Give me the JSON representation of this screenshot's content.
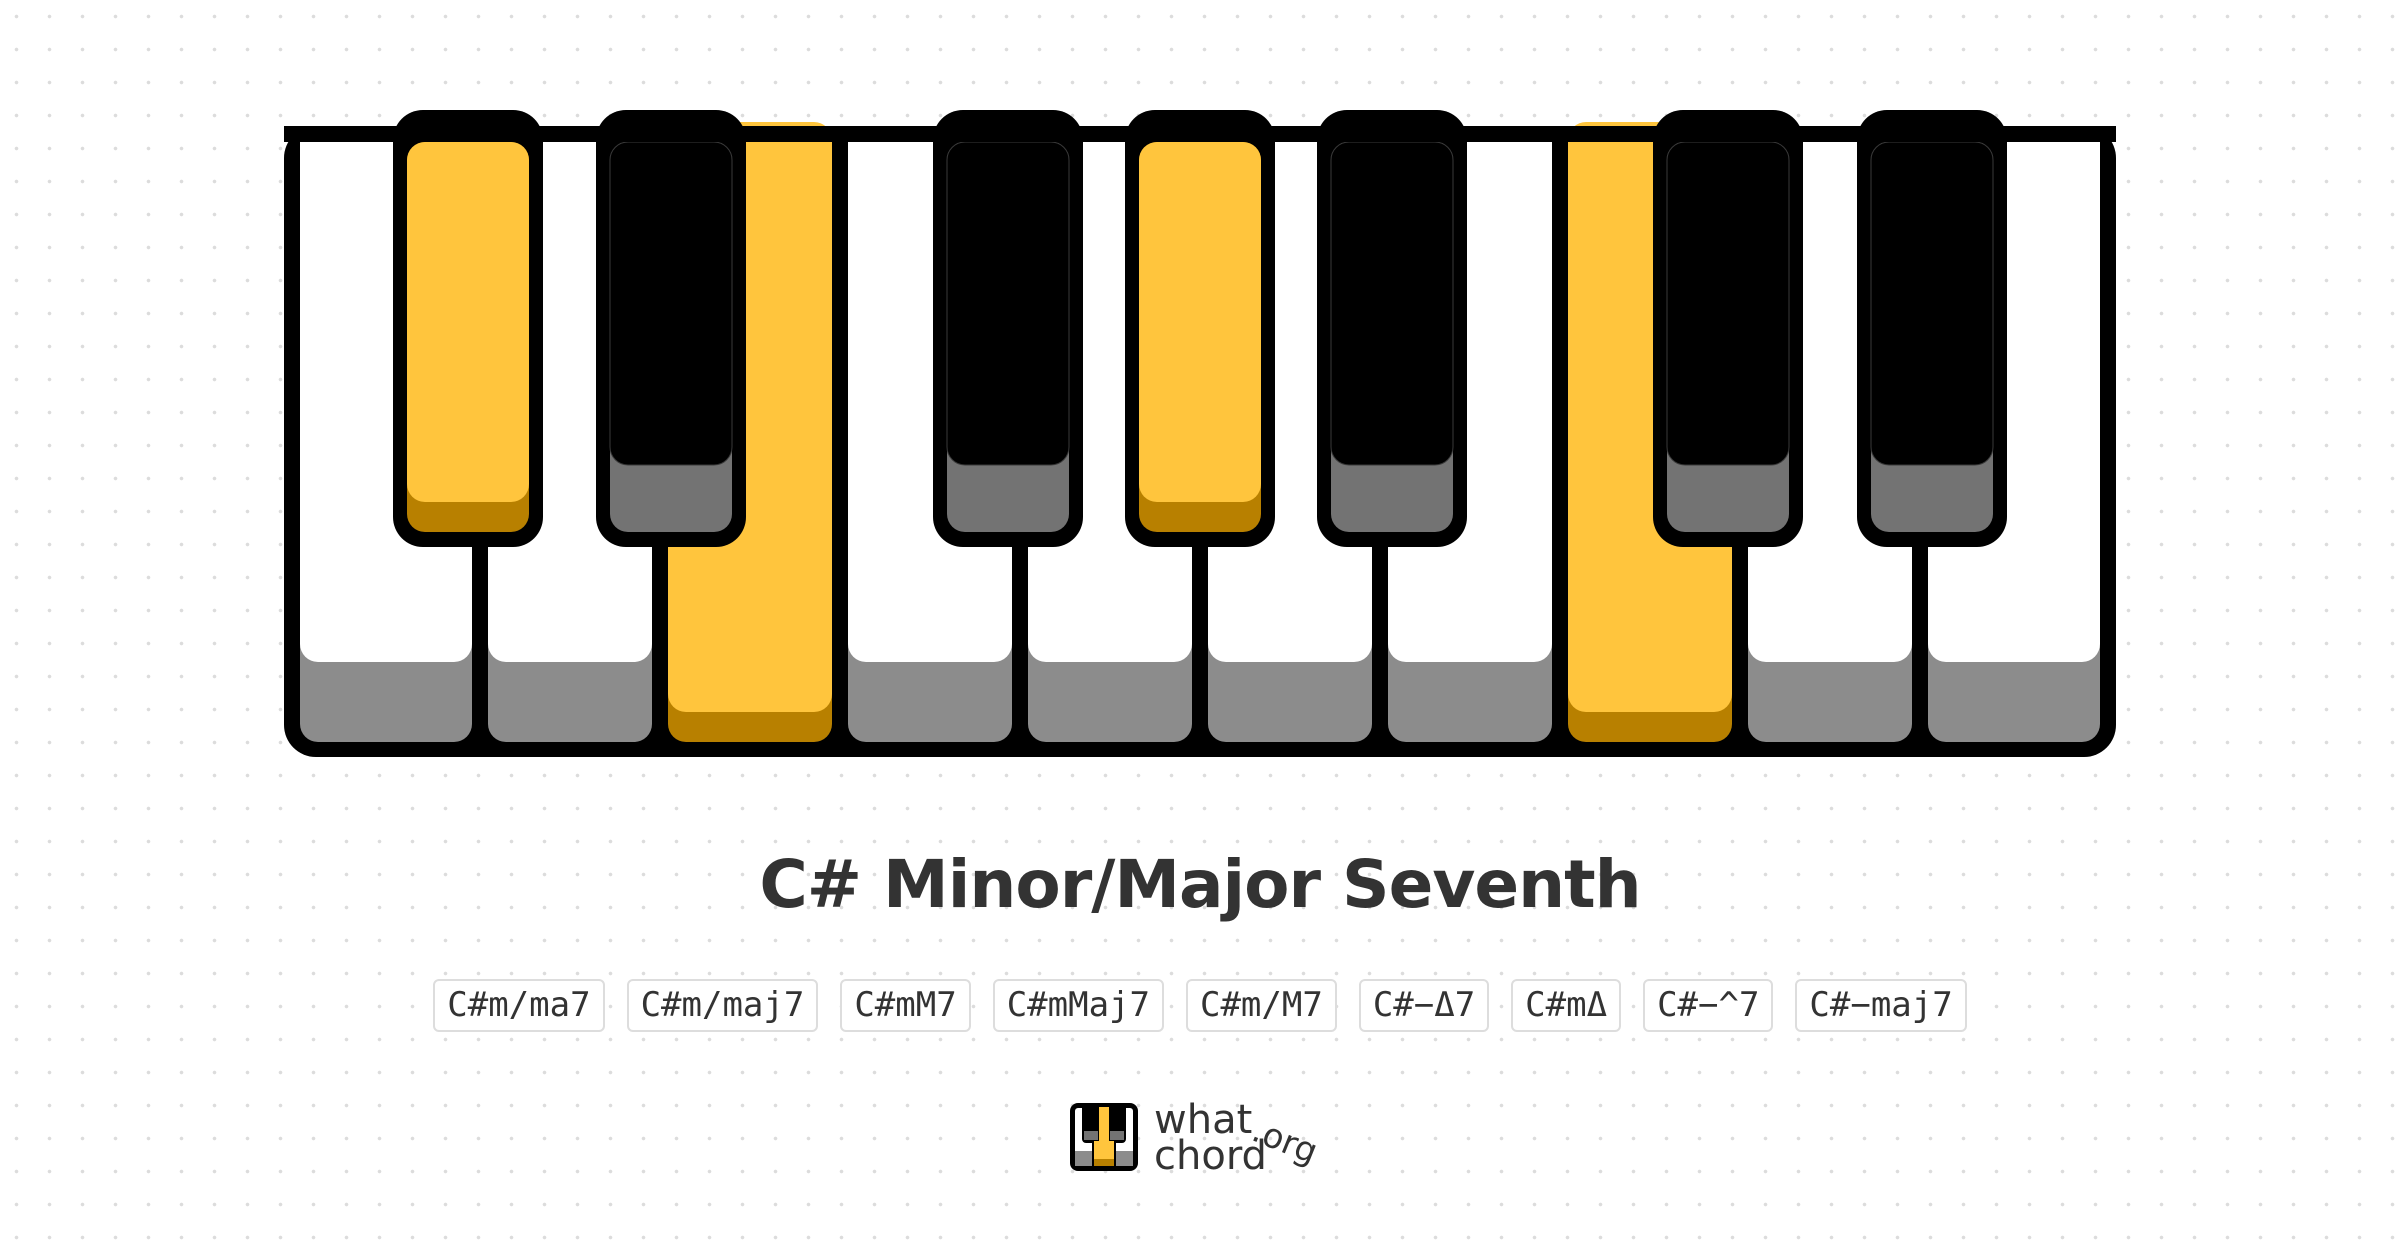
{
  "chord": {
    "title": "C# Minor/Major Seventh",
    "aliases": [
      "C#m/ma7",
      "C#m/maj7",
      "C#mM7",
      "C#mMaj7",
      "C#m/M7",
      "C#−Δ7",
      "C#mΔ",
      "C#−^7",
      "C#−maj7"
    ]
  },
  "keyboard": {
    "white_keys": [
      {
        "note": "C",
        "active": false
      },
      {
        "note": "D",
        "active": false
      },
      {
        "note": "E",
        "active": true
      },
      {
        "note": "F",
        "active": false
      },
      {
        "note": "G",
        "active": false
      },
      {
        "note": "A",
        "active": false
      },
      {
        "note": "B",
        "active": false
      },
      {
        "note": "C",
        "active": true
      },
      {
        "note": "D",
        "active": false
      },
      {
        "note": "E",
        "active": false
      }
    ],
    "black_keys": [
      {
        "note": "C#",
        "active": true
      },
      {
        "note": "D#",
        "active": false
      },
      {
        "note": "F#",
        "active": false
      },
      {
        "note": "G#",
        "active": true
      },
      {
        "note": "A#",
        "active": false
      },
      {
        "note": "C#",
        "active": false
      },
      {
        "note": "D#",
        "active": false
      }
    ],
    "colors": {
      "highlight": "#FFC53D",
      "highlight_shadow": "#B88000",
      "white": "#FFFFFF",
      "white_shadow": "#8C8C8C",
      "black": "#000000",
      "black_shadow": "#737373"
    }
  },
  "logo": {
    "line1": "what",
    "line2": "chord",
    "suffix": ".org"
  }
}
